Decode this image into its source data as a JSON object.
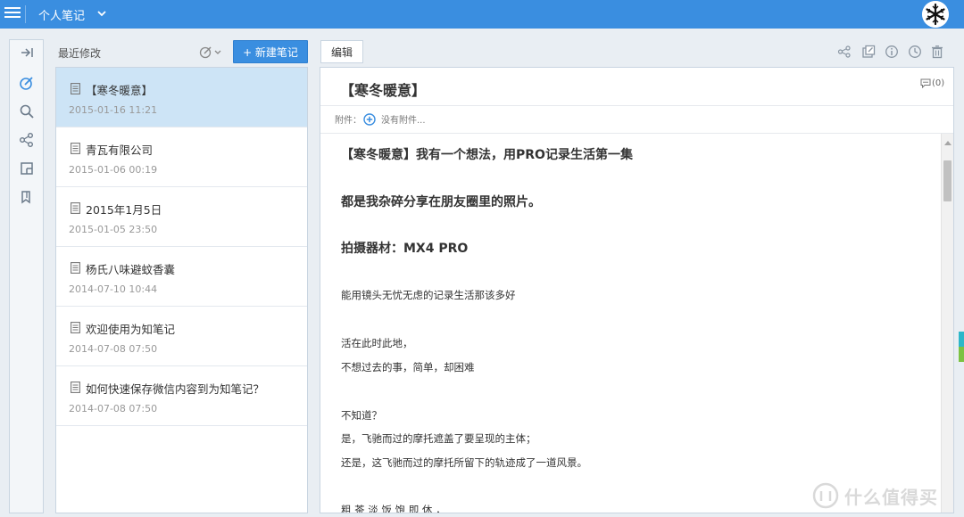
{
  "topbar": {
    "notebook_title": "个人笔记",
    "bg_color": "#3a8ee0"
  },
  "rail": {
    "items": [
      {
        "icon": "collapse-icon"
      },
      {
        "icon": "recent-edit-icon"
      },
      {
        "icon": "search-icon"
      },
      {
        "icon": "share-icon"
      },
      {
        "icon": "notebook-icon"
      },
      {
        "icon": "tag-icon"
      }
    ]
  },
  "list": {
    "header_label": "最近修改",
    "new_note_label": "+ 新建笔记",
    "notes": [
      {
        "title": "【寒冬暖意】",
        "date": "2015-01-16 11:21",
        "selected": true
      },
      {
        "title": "青瓦有限公司",
        "date": "2015-01-06 00:19",
        "selected": false
      },
      {
        "title": "2015年1月5日",
        "date": "2015-01-05 23:50",
        "selected": false
      },
      {
        "title": "杨氏八味避蚊香囊",
        "date": "2014-07-10 10:44",
        "selected": false
      },
      {
        "title": "欢迎使用为知笔记",
        "date": "2014-07-08 07:50",
        "selected": false
      },
      {
        "title": "如何快速保存微信内容到为知笔记？",
        "date": "2014-07-08 07:50",
        "selected": false
      }
    ]
  },
  "editor": {
    "edit_label": "编辑",
    "heading": "【寒冬暖意】",
    "comment_count": "(0)",
    "attach_label": "附件：",
    "attach_empty": "没有附件...",
    "toolbar_icons": [
      "share-icon",
      "open-external-icon",
      "info-icon",
      "history-icon",
      "trash-icon"
    ],
    "body_lines": [
      {
        "text": "【寒冬暖意】我有一个想法，用PRO记录生活第一集",
        "style": "big"
      },
      {
        "text": "都是我杂碎分享在朋友圈里的照片。",
        "style": "big"
      },
      {
        "text": "拍摄器材：MX4 PRO",
        "style": "big"
      },
      {
        "text": "能用镜头无忧无虑的记录生活那该多好",
        "style": "small"
      },
      {
        "text": "活在此时此地，",
        "style": "small"
      },
      {
        "text": "不想过去的事，简单，却困难",
        "style": "small"
      },
      {
        "text": "不知道？",
        "style": "small"
      },
      {
        "text": "是，飞驰而过的摩托遮盖了要呈现的主体；",
        "style": "small"
      },
      {
        "text": "还是，这飞驰而过的摩托所留下的轨迹成了一道风景。",
        "style": "small"
      },
      {
        "text": "粗 茶 淡 饭 饱 即 休 ，",
        "style": "small"
      }
    ]
  },
  "watermark": {
    "text": "什么值得买"
  }
}
